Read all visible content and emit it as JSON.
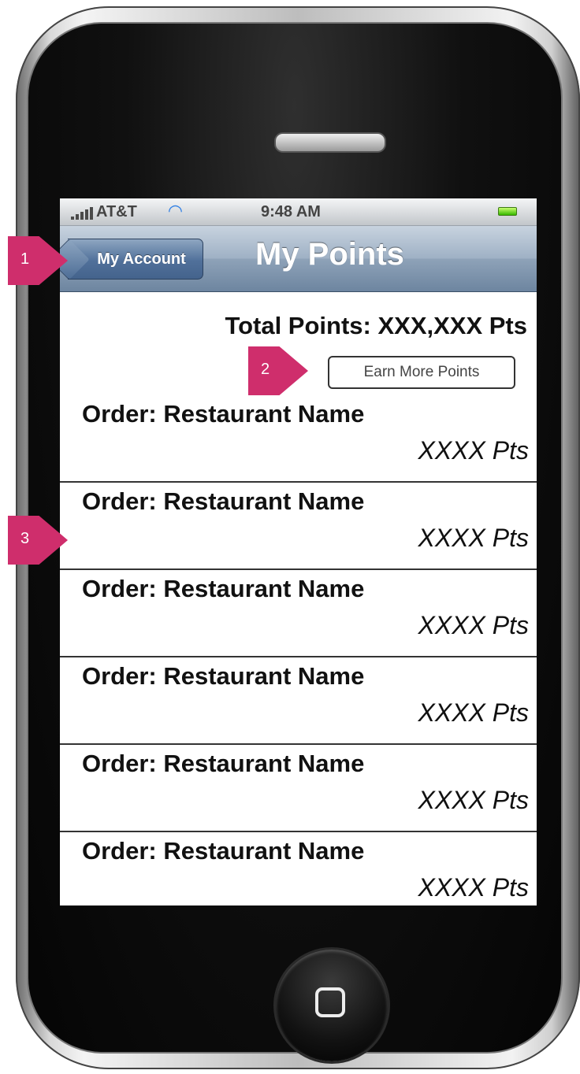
{
  "status_bar": {
    "carrier": "AT&T",
    "time": "9:48 AM"
  },
  "nav": {
    "back_label": "My Account",
    "title": "My Points"
  },
  "summary": {
    "total_points": "Total Points: XXX,XXX Pts",
    "earn_button_label": "Earn More Points"
  },
  "orders": [
    {
      "name": "Order: Restaurant Name",
      "points": "XXXX Pts"
    },
    {
      "name": "Order: Restaurant Name",
      "points": "XXXX Pts"
    },
    {
      "name": "Order: Restaurant Name",
      "points": "XXXX Pts"
    },
    {
      "name": "Order: Restaurant Name",
      "points": "XXXX Pts"
    },
    {
      "name": "Order: Restaurant Name",
      "points": "XXXX Pts"
    },
    {
      "name": "Order: Restaurant Name",
      "points": "XXXX Pts"
    }
  ],
  "annotations": [
    "1",
    "2",
    "3"
  ],
  "icons": [
    "signal-icon",
    "wifi-icon",
    "battery-icon",
    "back-arrow-icon",
    "home-button-icon"
  ],
  "colors": {
    "marker": "#cf2e6c",
    "nav_bar": "#8ea2b8",
    "battery": "#36b800",
    "wifi": "#2f7fe5"
  }
}
